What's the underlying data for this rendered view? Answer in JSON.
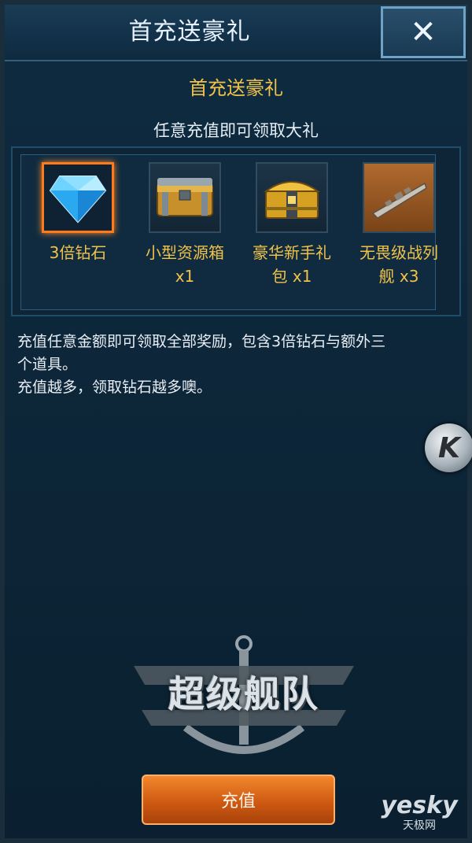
{
  "header": {
    "title": "首充送豪礼",
    "close_label": "✕"
  },
  "panel": {
    "subtitle": "首充送豪礼",
    "subtext": "任意充值即可领取大礼"
  },
  "rewards": [
    {
      "label_line1": "3倍钻石",
      "label_line2": "",
      "icon": "diamond-icon"
    },
    {
      "label_line1": "小型资源箱",
      "label_line2": "x1",
      "icon": "resource-crate-icon"
    },
    {
      "label_line1": "豪华新手礼",
      "label_line2": "包 x1",
      "icon": "gift-chest-icon"
    },
    {
      "label_line1": "无畏级战列",
      "label_line2": "舰 x3",
      "icon": "battleship-icon"
    }
  ],
  "description": {
    "line1": "充值任意金额即可领取全部奖励，包含3倍钻石与额外三",
    "line2": "个道具。",
    "line3": "充值越多，领取钻石越多噢。"
  },
  "k_badge": "K",
  "logo": {
    "text": "超级舰队"
  },
  "recharge_button": "充值",
  "watermark": {
    "brand": "yesky",
    "sub": "天极网"
  },
  "colors": {
    "accent": "#f0c24a",
    "button": "#e06a1c",
    "selected_border": "#ff7a1a"
  }
}
